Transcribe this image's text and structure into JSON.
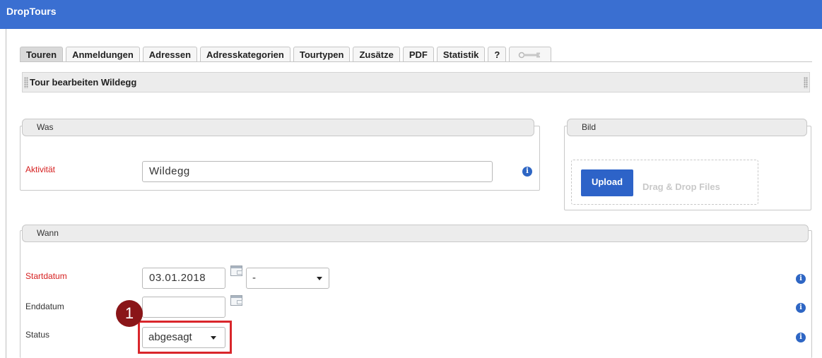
{
  "app": {
    "title": "DropTours"
  },
  "tabs": [
    {
      "label": "Touren",
      "active": true
    },
    {
      "label": "Anmeldungen"
    },
    {
      "label": "Adressen"
    },
    {
      "label": "Adresskategorien"
    },
    {
      "label": "Tourtypen"
    },
    {
      "label": "Zusätze"
    },
    {
      "label": "PDF"
    },
    {
      "label": "Statistik"
    },
    {
      "label": "?"
    },
    {
      "icon": "wrench-icon"
    }
  ],
  "header": {
    "title": "Tour bearbeiten Wildegg"
  },
  "was": {
    "legend": "Was",
    "aktivitaet_label": "Aktivität",
    "aktivitaet_value": "Wildegg"
  },
  "bild": {
    "legend": "Bild",
    "upload_label": "Upload",
    "drop_label": "Drag & Drop Files"
  },
  "wann": {
    "legend": "Wann",
    "startdatum_label": "Startdatum",
    "startdatum_value": "03.01.2018",
    "time_select_value": "-",
    "enddatum_label": "Enddatum",
    "enddatum_value": "",
    "status_label": "Status",
    "status_value": "abgesagt"
  },
  "annotation": {
    "marker": "1"
  },
  "colors": {
    "accent": "#3a6fd1",
    "required": "#d62020",
    "highlight": "#d9262b",
    "marker": "#8a1518"
  }
}
